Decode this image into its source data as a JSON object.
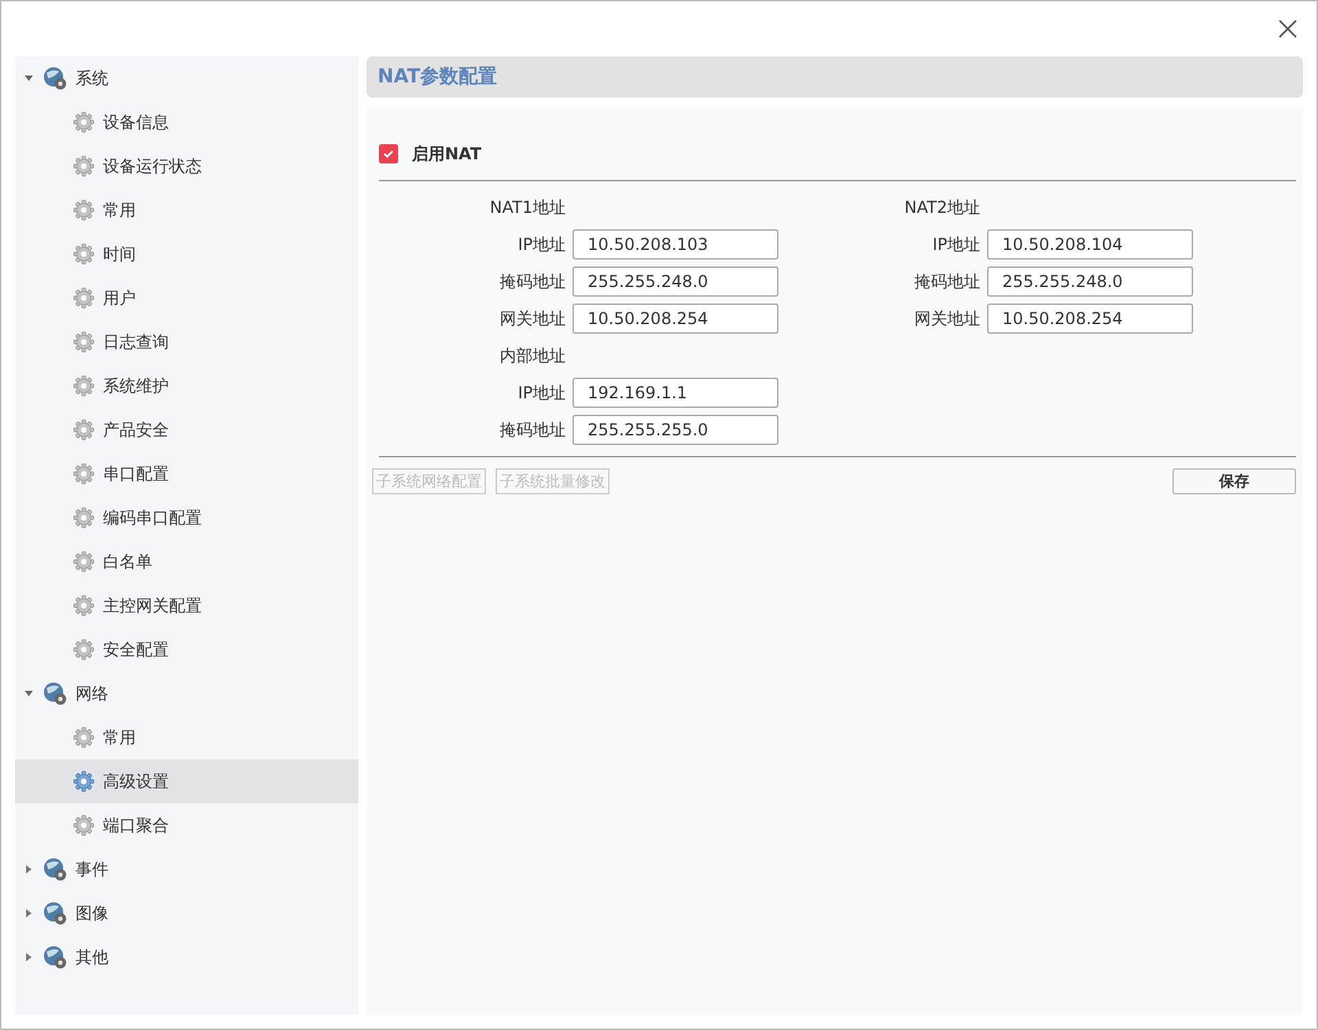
{
  "sidebar": {
    "groups": [
      {
        "label": "系统",
        "expanded": true,
        "children": [
          {
            "label": "设备信息",
            "selected": false
          },
          {
            "label": "设备运行状态",
            "selected": false
          },
          {
            "label": "常用",
            "selected": false
          },
          {
            "label": "时间",
            "selected": false
          },
          {
            "label": "用户",
            "selected": false
          },
          {
            "label": "日志查询",
            "selected": false
          },
          {
            "label": "系统维护",
            "selected": false
          },
          {
            "label": "产品安全",
            "selected": false
          },
          {
            "label": "串口配置",
            "selected": false
          },
          {
            "label": "编码串口配置",
            "selected": false
          },
          {
            "label": "白名单",
            "selected": false
          },
          {
            "label": "主控网关配置",
            "selected": false
          },
          {
            "label": "安全配置",
            "selected": false
          }
        ]
      },
      {
        "label": "网络",
        "expanded": true,
        "children": [
          {
            "label": "常用",
            "selected": false
          },
          {
            "label": "高级设置",
            "selected": true
          },
          {
            "label": "端口聚合",
            "selected": false
          }
        ]
      },
      {
        "label": "事件",
        "expanded": false
      },
      {
        "label": "图像",
        "expanded": false
      },
      {
        "label": "其他",
        "expanded": false
      }
    ]
  },
  "panel": {
    "title": "NAT参数配置",
    "enable": {
      "label": "启用NAT",
      "checked": true
    },
    "columns": [
      {
        "sections": [
          {
            "heading": "NAT1地址",
            "fields": [
              {
                "label": "IP地址",
                "value": "10.50.208.103"
              },
              {
                "label": "掩码地址",
                "value": "255.255.248.0"
              },
              {
                "label": "网关地址",
                "value": "10.50.208.254"
              }
            ]
          },
          {
            "heading": "内部地址",
            "fields": [
              {
                "label": "IP地址",
                "value": "192.169.1.1"
              },
              {
                "label": "掩码地址",
                "value": "255.255.255.0"
              }
            ]
          }
        ]
      },
      {
        "sections": [
          {
            "heading": "NAT2地址",
            "fields": [
              {
                "label": "IP地址",
                "value": "10.50.208.104"
              },
              {
                "label": "掩码地址",
                "value": "255.255.248.0"
              },
              {
                "label": "网关地址",
                "value": "10.50.208.254"
              }
            ]
          }
        ]
      }
    ],
    "buttons": [
      {
        "label": "子系统网络配置",
        "disabled": true
      },
      {
        "label": "子系统批量修改",
        "disabled": true
      }
    ],
    "save": {
      "label": "保存",
      "disabled": false
    }
  }
}
